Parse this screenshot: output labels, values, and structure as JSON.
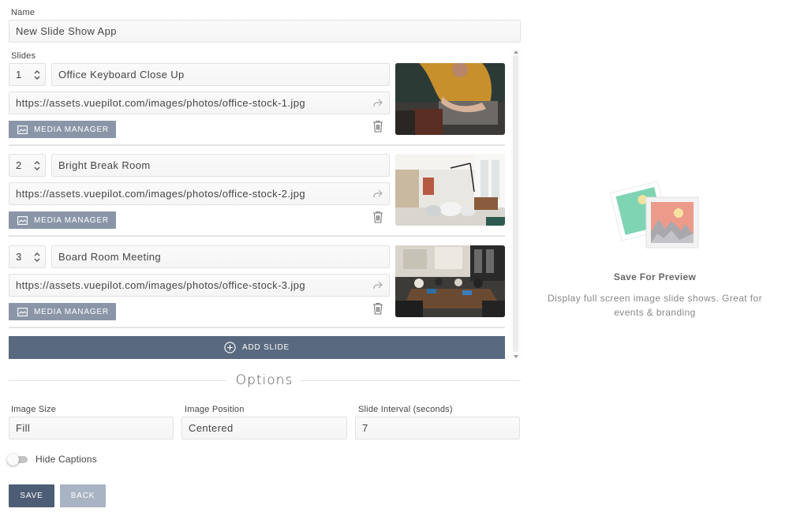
{
  "name": {
    "label": "Name",
    "value": "New Slide Show App"
  },
  "slides": {
    "label": "Slides",
    "media_manager_label": "MEDIA MANAGER",
    "add_label": "ADD SLIDE",
    "items": [
      {
        "number": "1",
        "title": "Office Keyboard Close Up",
        "url": "https://assets.vuepilot.com/images/photos/office-stock-1.jpg"
      },
      {
        "number": "2",
        "title": "Bright Break Room",
        "url": "https://assets.vuepilot.com/images/photos/office-stock-2.jpg"
      },
      {
        "number": "3",
        "title": "Board Room Meeting",
        "url": "https://assets.vuepilot.com/images/photos/office-stock-3.jpg"
      }
    ]
  },
  "options": {
    "title": "Options",
    "image_size": {
      "label": "Image Size",
      "value": "Fill"
    },
    "image_position": {
      "label": "Image Position",
      "value": "Centered"
    },
    "slide_interval": {
      "label": "Slide Interval (seconds)",
      "value": "7"
    },
    "hide_captions": {
      "label": "Hide Captions",
      "enabled": false
    }
  },
  "actions": {
    "save_label": "SAVE",
    "back_label": "BACK"
  },
  "preview": {
    "title": "Save For Preview",
    "description": "Display full screen image slide shows. Great for events & branding"
  },
  "colors": {
    "button_dark": "#4d5d75",
    "add_slide": "#59697f",
    "media_manager": "#8a96a8",
    "back_button": "#a8b3c3",
    "preview_green": "#7fd4b4",
    "preview_red": "#ec9a8a"
  },
  "icons": [
    "spinner-icon",
    "share-icon",
    "image-icon",
    "trash-icon",
    "plus-circle-icon",
    "photos-icon"
  ]
}
